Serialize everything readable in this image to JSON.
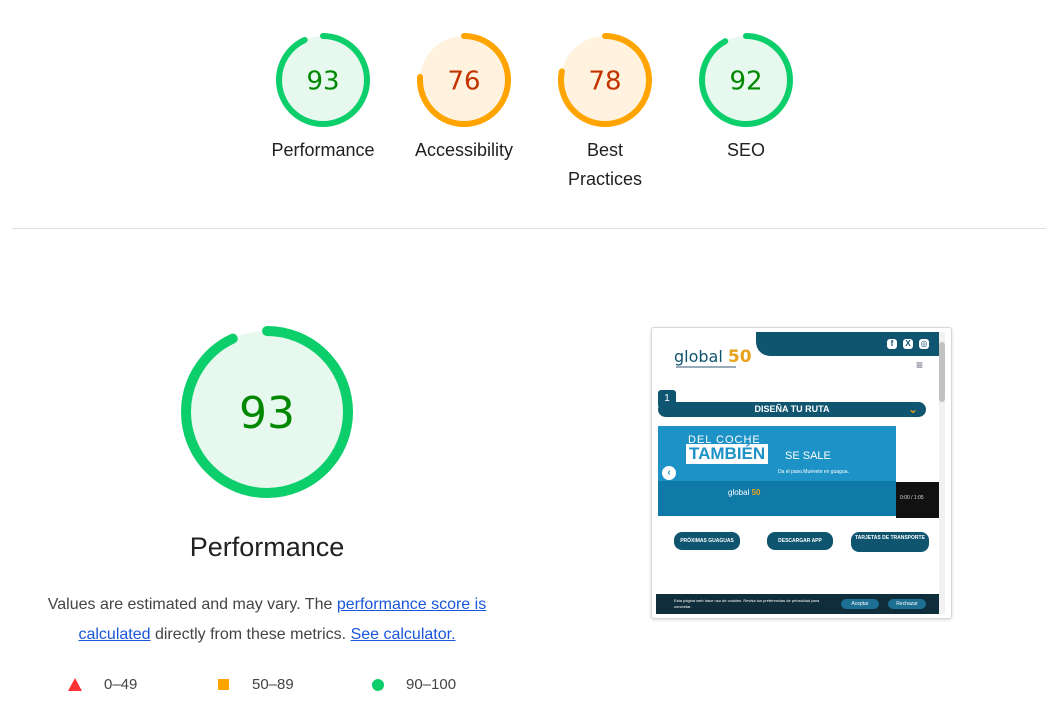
{
  "colors": {
    "pass": "#0cce6b",
    "pass_text": "#008800",
    "pass_fill": "#e7f8ee",
    "average": "#ffa400",
    "average_text": "#c33300",
    "average_fill": "#fff3e0",
    "fail": "#ff3333",
    "track": "#e0e0e0"
  },
  "gauges": [
    {
      "score": 93,
      "label": "Performance",
      "rating": "pass"
    },
    {
      "score": 76,
      "label": "Accessibility",
      "rating": "average"
    },
    {
      "score": 78,
      "label": "Best Practices",
      "rating": "average"
    },
    {
      "score": 92,
      "label": "SEO",
      "rating": "pass"
    }
  ],
  "main": {
    "score": 93,
    "title": "Performance",
    "desc_prefix": "Values are estimated and may vary. The ",
    "desc_link1": "performance score is calculated",
    "desc_middle": " directly from these metrics. ",
    "desc_link2": "See calculator."
  },
  "legend": {
    "fail": "0–49",
    "average": "50–89",
    "pass": "90–100"
  },
  "thumbnail": {
    "logo": "global",
    "logo_badge": "50",
    "step_number": "1",
    "route_label": "DISEÑA TU RUTA",
    "banner_line1": "DEL COCHE",
    "banner_line2": "TAMBIÉN",
    "banner_line3": "SE SALE",
    "banner_tagline": "Da el paso.Muévete en guagua.",
    "banner_logo": "global",
    "banner_badge": "50",
    "video_time": "0:00 / 1:05",
    "buttons": [
      "PRÓXIMAS GUAGUAS",
      "DESCARGAR APP",
      "TARJETAS DE TRANSPORTE"
    ],
    "cookie_text": "Esta página web hace uso de cookies. Revisa tus preferencias de privacidad para concretar.",
    "accept": "Aceptar",
    "reject": "Rechazar"
  }
}
